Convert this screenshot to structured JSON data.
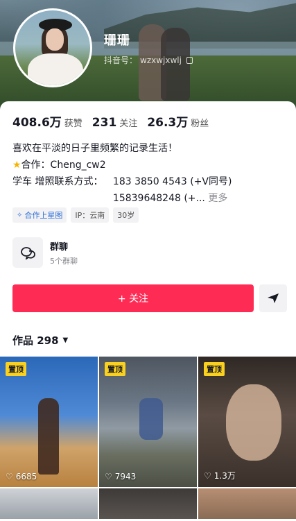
{
  "profile": {
    "name": "珊珊",
    "uid_label": "抖音号：",
    "uid_value": "wzxwjxwlj"
  },
  "stats": [
    {
      "value": "408.6万",
      "label": "获赞"
    },
    {
      "value": "231",
      "label": "关注"
    },
    {
      "value": "26.3万",
      "label": "粉丝"
    }
  ],
  "bio": {
    "line1": "喜欢在平淡的日子里频繁的记录生活！",
    "line2": "合作：Cheng_cw2",
    "line3_label": "学车 增照联系方式：",
    "phone1": "183 3850 4543 (+V同号)",
    "phone2": "15839648248 (+...",
    "more": "更多"
  },
  "tags": [
    "合作上星图",
    "IP：云南",
    "30岁"
  ],
  "group": {
    "name": "群聊",
    "sub": "5个群聊"
  },
  "actions": {
    "follow_label": "+ 关注"
  },
  "works": {
    "label": "作品 298"
  },
  "videos": [
    {
      "pinned": "置顶",
      "likes": "6685"
    },
    {
      "pinned": "置顶",
      "likes": "7943"
    },
    {
      "pinned": "置顶",
      "likes": "1.3万"
    }
  ],
  "colors": {
    "accent": "#fe2c55",
    "pin": "#fad11e",
    "link": "#2a6dd9"
  }
}
